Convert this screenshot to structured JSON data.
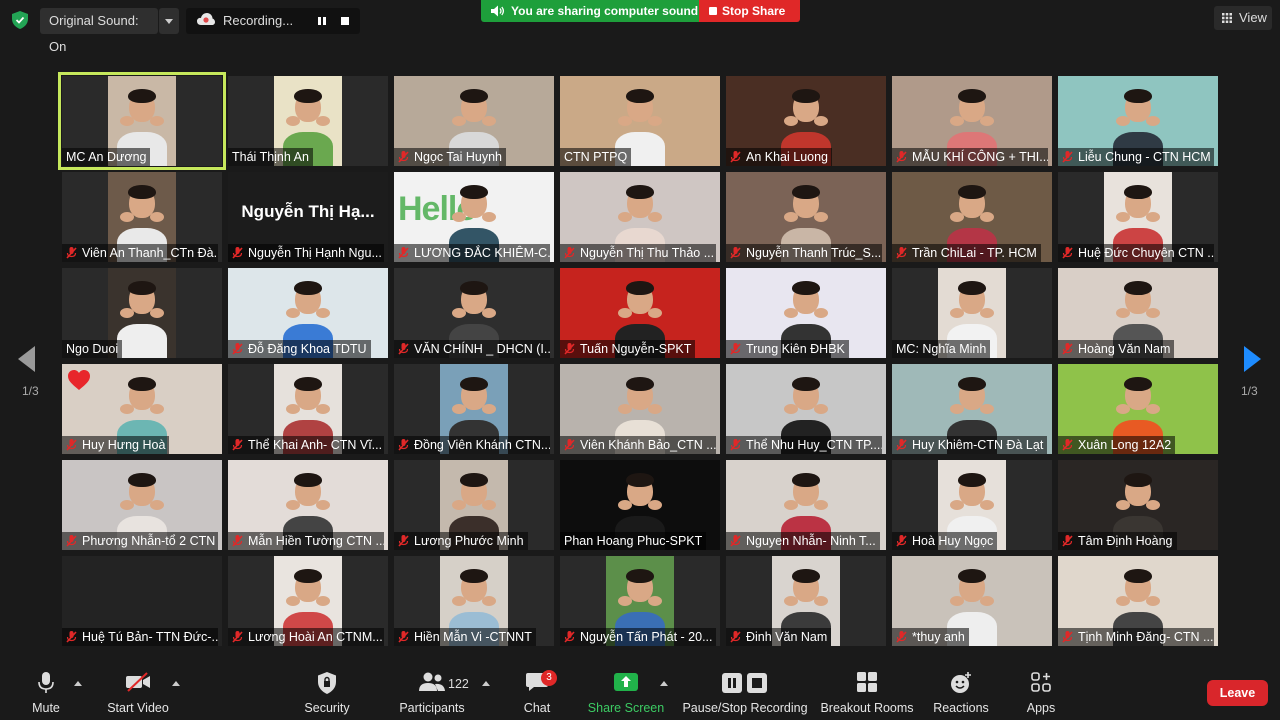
{
  "top": {
    "original_sound": "Original Sound: On",
    "recording": "Recording...",
    "sharing_notice": "You are sharing computer sound",
    "stop_share": "Stop Share",
    "view": "View"
  },
  "pagination": {
    "left": "1/3",
    "right": "1/3"
  },
  "tiles": [
    {
      "name": "MC An Dương",
      "muted": false,
      "bg": "#2a2a2a",
      "photo": "#c9b8a6",
      "shirt": "#e8e8e8",
      "speaker": true
    },
    {
      "name": "Thái Thịnh An",
      "muted": false,
      "bg": "#2a2a2a",
      "photo": "#e9e2c6",
      "shirt": "#6aa84f"
    },
    {
      "name": "Ngọc Tai Huynh",
      "muted": true,
      "bg": "#b7a999",
      "photo": "#b7a999",
      "shirt": "#d8d8d8",
      "full": true
    },
    {
      "name": "CTN PTPQ",
      "muted": false,
      "bg": "#caa987",
      "photo": "#caa987",
      "shirt": "#f0f0f0",
      "full": true
    },
    {
      "name": "An Khai Luong",
      "muted": true,
      "bg": "#4a2e23",
      "photo": "#4a2e23",
      "shirt": "#c0362c",
      "full": true
    },
    {
      "name": "MẪU KHÍ CÔNG + THI...",
      "muted": true,
      "bg": "#b09a8a",
      "photo": "#b09a8a",
      "shirt": "#d77",
      "full": true
    },
    {
      "name": "Liễu Chung - CTN HCM",
      "muted": true,
      "bg": "#8fc5c0",
      "photo": "#8fc5c0",
      "shirt": "#2f3a44",
      "full": true
    },
    {
      "name": "Viên An Thanh_CTn Đà...",
      "muted": true,
      "bg": "#2a2a2a",
      "photo": "#6d5a4a",
      "shirt": "#e9e9e9"
    },
    {
      "name": "Nguyễn Thị Hạnh Ngu...",
      "muted": true,
      "bg": "#1c1c1c",
      "text": "Nguyễn Thị Hạ..."
    },
    {
      "name": "LƯƠNG ĐẮC KHIÊM-C...",
      "muted": true,
      "bg": "#f2f2f2",
      "photo": "#f2f2f2",
      "shirt": "#356",
      "full": true,
      "hello": "Hello"
    },
    {
      "name": "Nguyễn Thị Thu Thảo ...",
      "muted": true,
      "bg": "#cfc6c3",
      "photo": "#cfc6c3",
      "shirt": "#e8d8d0",
      "full": true
    },
    {
      "name": "Nguyễn Thanh Trúc_S...",
      "muted": true,
      "bg": "#7b6356",
      "photo": "#7b6356",
      "shirt": "#c9b6a6",
      "full": true
    },
    {
      "name": "Trần ChiLai - TP. HCM",
      "muted": true,
      "bg": "#6e5a46",
      "photo": "#6e5a46",
      "shirt": "#b43646",
      "full": true
    },
    {
      "name": "Huệ Đức Chuyên CTN ...",
      "muted": true,
      "bg": "#2a2a2a",
      "photo": "#e8e2dc",
      "shirt": "#c44"
    },
    {
      "name": "Ngo Duoi",
      "muted": false,
      "bg": "#2a2a2a",
      "photo": "#3a332d",
      "shirt": "#eee"
    },
    {
      "name": "Đỗ Đăng Khoa TDTU",
      "muted": true,
      "bg": "#dde6ea",
      "photo": "#dde6ea",
      "shirt": "#3a7bd5",
      "full": true
    },
    {
      "name": "VĂN CHÍNH _ DHCN (I...",
      "muted": true,
      "bg": "#2e2e2e",
      "photo": "#2e2e2e",
      "shirt": "#444",
      "full": true
    },
    {
      "name": "Tuấn Nguyễn-SPKT",
      "muted": true,
      "bg": "#c6231e",
      "photo": "#c6231e",
      "shirt": "#222",
      "full": true
    },
    {
      "name": "Trung Kiên ĐHBK",
      "muted": true,
      "bg": "#e8e6f0",
      "photo": "#e8e6f0",
      "shirt": "#333",
      "full": true
    },
    {
      "name": "MC: Nghĩa Minh",
      "muted": false,
      "bg": "#2a2a2a",
      "photo": "#e3dbd3",
      "shirt": "#f2f2f2"
    },
    {
      "name": "Hoàng Văn Nam",
      "muted": true,
      "bg": "#d9cfc7",
      "photo": "#d9cfc7",
      "shirt": "#555",
      "full": true
    },
    {
      "name": "Huy Hưng Hoà",
      "muted": true,
      "bg": "#d9cfc5",
      "photo": "#d9cfc5",
      "shirt": "#6cb6b3",
      "full": true,
      "heart": true
    },
    {
      "name": "Thể Khai Anh- CTN Vĩ...",
      "muted": true,
      "bg": "#2a2a2a",
      "photo": "#e6e1dc",
      "shirt": "#b04242"
    },
    {
      "name": "Đồng Viên Khánh CTN...",
      "muted": true,
      "bg": "#2a2a2a",
      "photo": "#7aa0b8",
      "shirt": "#333"
    },
    {
      "name": "Viên Khánh Bảo_CTN ...",
      "muted": true,
      "bg": "#b9b3ad",
      "photo": "#b9b3ad",
      "shirt": "#e8e0d6",
      "full": true
    },
    {
      "name": "Thể Nhu Huy_CTN TP....",
      "muted": true,
      "bg": "#c7c7c7",
      "photo": "#c7c7c7",
      "shirt": "#222",
      "full": true
    },
    {
      "name": "Huy Khiêm-CTN Đà Lạt",
      "muted": true,
      "bg": "#9fb9b8",
      "photo": "#9fb9b8",
      "shirt": "#333",
      "full": true
    },
    {
      "name": "Xuân Long 12A2",
      "muted": true,
      "bg": "#8fc24a",
      "photo": "#8fc24a",
      "shirt": "#e85a23",
      "full": true
    },
    {
      "name": "Phương Nhẫn-tổ 2 CTN",
      "muted": true,
      "bg": "#c9c5c4",
      "photo": "#c9c5c4",
      "shirt": "#e8e3df",
      "full": true
    },
    {
      "name": "Mẫn Hiền Tường CTN ...",
      "muted": true,
      "bg": "#e3dcd8",
      "photo": "#e3dcd8",
      "shirt": "#444",
      "full": true
    },
    {
      "name": "Lương Phước Minh",
      "muted": true,
      "bg": "#2a2a2a",
      "photo": "#c4b9ad",
      "shirt": "#3b2f2a"
    },
    {
      "name": "Phan Hoang Phuc-SPKT",
      "muted": false,
      "bg": "#0d0d0d",
      "photo": "#0d0d0d",
      "shirt": "#1a1a1a",
      "full": true
    },
    {
      "name": "Nguyen Nhẫn- Ninh T...",
      "muted": true,
      "bg": "#d8d2cc",
      "photo": "#d8d2cc",
      "shirt": "#b34",
      "full": true
    },
    {
      "name": "Hoà Huy Ngọc",
      "muted": true,
      "bg": "#2a2a2a",
      "photo": "#e6e0da",
      "shirt": "#f0f0f0"
    },
    {
      "name": "Tâm Định Hoàng",
      "muted": true,
      "bg": "#2a2624",
      "photo": "#2a2624",
      "shirt": "#3a3632",
      "full": true
    },
    {
      "name": "Huệ Tú Bản- TTN Đức-...",
      "muted": true,
      "bg": "#232323",
      "empty": true
    },
    {
      "name": "Lương Hoài An CTNM...",
      "muted": true,
      "bg": "#2a2a2a",
      "photo": "#e9e4df",
      "shirt": "#d04848"
    },
    {
      "name": "Hiền Mẫn Vi -CTNNT",
      "muted": true,
      "bg": "#2a2a2a",
      "photo": "#d6d0c8",
      "shirt": "#9bbdd4"
    },
    {
      "name": "Nguyễn Tấn Phát - 20...",
      "muted": true,
      "bg": "#2a2a2a",
      "photo": "#5c8f4a",
      "shirt": "#3a6fb5"
    },
    {
      "name": "Đinh Văn Nam",
      "muted": true,
      "bg": "#2a2a2a",
      "photo": "#d9d4cf",
      "shirt": "#3b3b3b"
    },
    {
      "name": "*thuy anh",
      "muted": true,
      "bg": "#c9c2ba",
      "photo": "#c9c2ba",
      "shirt": "#eee",
      "full": true
    },
    {
      "name": "Tịnh Minh Đăng- CTN ...",
      "muted": true,
      "bg": "#e0d7cc",
      "photo": "#e0d7cc",
      "shirt": "#444",
      "full": true
    }
  ],
  "toolbar": {
    "mute": "Mute",
    "start_video": "Start Video",
    "security": "Security",
    "participants": "Participants",
    "participants_count": "122",
    "chat": "Chat",
    "chat_badge": "3",
    "share_screen": "Share Screen",
    "recording": "Pause/Stop Recording",
    "breakout": "Breakout Rooms",
    "reactions": "Reactions",
    "apps": "Apps",
    "leave": "Leave"
  },
  "colors": {
    "speaker_outline": "#c6e85c",
    "share_green": "#1e9f3b",
    "stop_red": "#e02828",
    "leave_red": "#d9262b",
    "nav_blue": "#1e8cff"
  }
}
